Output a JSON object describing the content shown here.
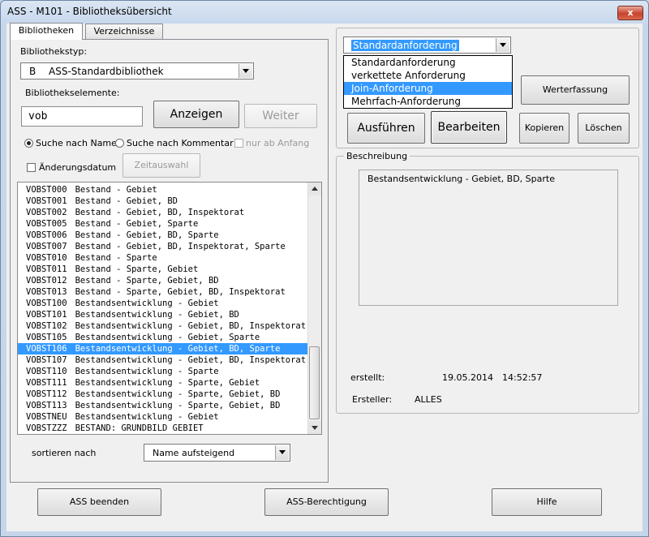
{
  "window": {
    "title": "ASS - M101 - Bibliotheksübersicht",
    "close": "x"
  },
  "tabs": [
    {
      "label": "Bibliotheken"
    },
    {
      "label": "Verzeichnisse"
    }
  ],
  "library": {
    "type_label": "Bibliothekstyp:",
    "type_code": "B",
    "type_value": "ASS-Standardbibliothek",
    "elements_label": "Bibliothekselemente:",
    "search_value": "vob",
    "show_button": "Anzeigen",
    "next_button": "Weiter",
    "search_by_name": "Suche nach Name",
    "search_by_comment": "Suche nach Kommentar",
    "only_from_start": "nur ab Anfang",
    "change_date": "Änderungsdatum",
    "time_select": "Zeitauswahl",
    "sort_label": "sortieren nach",
    "sort_value": "Name aufsteigend"
  },
  "list": [
    {
      "code": "VOBST000",
      "desc": "Bestand - Gebiet"
    },
    {
      "code": "VOBST001",
      "desc": "Bestand - Gebiet, BD"
    },
    {
      "code": "VOBST002",
      "desc": "Bestand - Gebiet, BD, Inspektorat"
    },
    {
      "code": "VOBST005",
      "desc": "Bestand - Gebiet, Sparte"
    },
    {
      "code": "VOBST006",
      "desc": "Bestand - Gebiet, BD, Sparte"
    },
    {
      "code": "VOBST007",
      "desc": "Bestand - Gebiet, BD, Inspektorat, Sparte"
    },
    {
      "code": "VOBST010",
      "desc": "Bestand - Sparte"
    },
    {
      "code": "VOBST011",
      "desc": "Bestand - Sparte, Gebiet"
    },
    {
      "code": "VOBST012",
      "desc": "Bestand - Sparte, Gebiet, BD"
    },
    {
      "code": "VOBST013",
      "desc": "Bestand - Sparte, Gebiet, BD, Inspektorat"
    },
    {
      "code": "VOBST100",
      "desc": "Bestandsentwicklung - Gebiet"
    },
    {
      "code": "VOBST101",
      "desc": "Bestandsentwicklung - Gebiet, BD"
    },
    {
      "code": "VOBST102",
      "desc": "Bestandsentwicklung - Gebiet, BD, Inspektorat"
    },
    {
      "code": "VOBST105",
      "desc": "Bestandsentwicklung - Gebiet, Sparte"
    },
    {
      "code": "VOBST106",
      "desc": "Bestandsentwicklung - Gebiet, BD, Sparte"
    },
    {
      "code": "VOBST107",
      "desc": "Bestandsentwicklung - Gebiet, BD, Inspektorat"
    },
    {
      "code": "VOBST110",
      "desc": "Bestandsentwicklung - Sparte"
    },
    {
      "code": "VOBST111",
      "desc": "Bestandsentwicklung - Sparte, Gebiet"
    },
    {
      "code": "VOBST112",
      "desc": "Bestandsentwicklung - Sparte, Gebiet, BD"
    },
    {
      "code": "VOBST113",
      "desc": "Bestandsentwicklung - Sparte, Gebiet, BD"
    },
    {
      "code": "VOBSTNEU",
      "desc": "Bestandsentwicklung - Gebiet"
    },
    {
      "code": "VOBSTZZZ",
      "desc": "BESTAND: GRUNDBILD GEBIET"
    }
  ],
  "selected_index": 14,
  "request": {
    "selected": "Standardanforderung",
    "options": [
      "Standardanforderung",
      "verkettete Anforderung",
      "Join-Anforderung",
      "Mehrfach-Anforderung"
    ],
    "highlighted_index": 2
  },
  "actions": {
    "value_entry": "Werterfassung",
    "execute": "Ausführen",
    "edit": "Bearbeiten",
    "copy": "Kopieren",
    "delete": "Löschen"
  },
  "description": {
    "group_label": "Beschreibung",
    "text": "Bestandsentwicklung - Gebiet, BD, Sparte",
    "created_label": "erstellt:",
    "created_date": "19.05.2014",
    "created_time": "14:52:57",
    "creator_label": "Ersteller:",
    "creator_value": "ALLES"
  },
  "footer": {
    "quit": "ASS beenden",
    "permission": "ASS-Berechtigung",
    "help": "Hilfe"
  }
}
